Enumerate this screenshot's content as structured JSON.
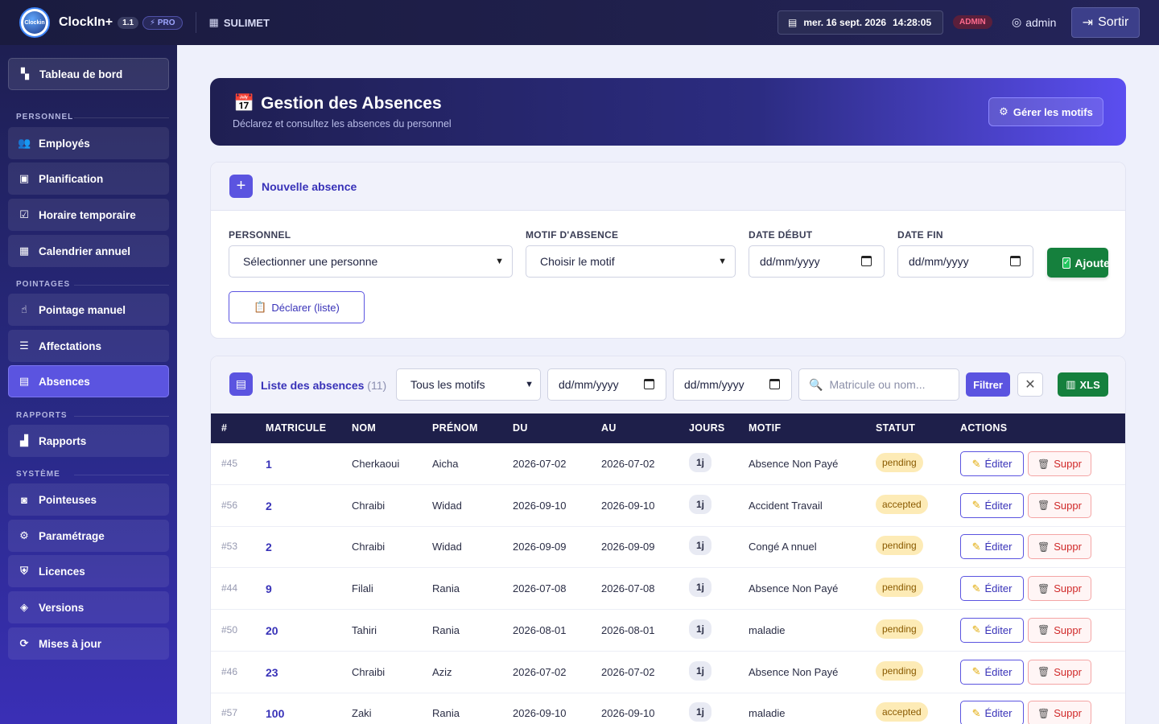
{
  "topbar": {
    "logo_text": "Clockin",
    "brand": "ClockIn+",
    "version": "1.1",
    "pro": "⚡ PRO",
    "company": "SULIMET",
    "datetime_date": "mer. 16 sept. 2026",
    "datetime_time": "14:28:05",
    "role_badge": "ADMIN",
    "user": "admin",
    "logout": "Sortir"
  },
  "sidebar": {
    "dashboard": "Tableau de bord",
    "sections": {
      "personnel": "PERSONNEL",
      "pointages": "POINTAGES",
      "rapports": "RAPPORTS",
      "systeme": "SYSTÈME"
    },
    "items": [
      {
        "label": "Employés",
        "icon": "users-icon"
      },
      {
        "label": "Planification",
        "icon": "calendar-icon"
      },
      {
        "label": "Horaire temporaire",
        "icon": "calendar-check-icon"
      },
      {
        "label": "Calendrier annuel",
        "icon": "calendar-annual-icon"
      },
      {
        "label": "Pointage manuel",
        "icon": "hand-pointer-icon"
      },
      {
        "label": "Affectations",
        "icon": "sliders-icon"
      },
      {
        "label": "Absences",
        "icon": "calendar-x-icon"
      },
      {
        "label": "Rapports",
        "icon": "bar-chart-icon"
      },
      {
        "label": "Pointeuses",
        "icon": "device-icon"
      },
      {
        "label": "Paramétrage",
        "icon": "gear-icon"
      },
      {
        "label": "Licences",
        "icon": "shield-icon"
      },
      {
        "label": "Versions",
        "icon": "layers-icon"
      },
      {
        "label": "Mises à jour",
        "icon": "refresh-icon"
      }
    ]
  },
  "header": {
    "title": "Gestion des Absences",
    "subtitle": "Déclarez et consultez les absences du personnel",
    "manage_button": "Gérer les motifs"
  },
  "new_absence": {
    "title": "Nouvelle absence",
    "personnel_label": "PERSONNEL",
    "personnel_value": "Sélectionner une personne",
    "motif_label": "MOTIF D'ABSENCE",
    "motif_value": "Choisir le motif",
    "start_label": "DATE DÉBUT",
    "start_value": "dd/mm/yyyy",
    "end_label": "DATE FIN",
    "end_value": "dd/mm/yyyy",
    "add_button": "Ajouter",
    "declare_button": "Déclarer (liste)"
  },
  "list": {
    "title": "Liste des absences",
    "count": "(11)",
    "motif_filter": "Tous les motifs",
    "date_from": "dd/mm/yyyy",
    "date_to": "dd/mm/yyyy",
    "search_placeholder": "Matricule ou nom...",
    "filter_button": "Filtrer",
    "clear_button": "✕",
    "export_button": "XLS",
    "columns": [
      "#",
      "MATRICULE",
      "NOM",
      "PRÉNOM",
      "DU",
      "AU",
      "JOURS",
      "MOTIF",
      "STATUT",
      "ACTIONS"
    ],
    "edit_label": "Éditer",
    "delete_label": "Suppr",
    "rows": [
      {
        "id": "#45",
        "matricule": "1",
        "nom": "Cherkaoui",
        "prenom": "Aicha",
        "du": "2026-07-02",
        "au": "2026-07-02",
        "jours": "1j",
        "motif": "Absence Non Payé",
        "statut": "pending"
      },
      {
        "id": "#56",
        "matricule": "2",
        "nom": "Chraibi",
        "prenom": "Widad",
        "du": "2026-09-10",
        "au": "2026-09-10",
        "jours": "1j",
        "motif": "Accident Travail",
        "statut": "accepted"
      },
      {
        "id": "#53",
        "matricule": "2",
        "nom": "Chraibi",
        "prenom": "Widad",
        "du": "2026-09-09",
        "au": "2026-09-09",
        "jours": "1j",
        "motif": "Congé A nnuel",
        "statut": "pending"
      },
      {
        "id": "#44",
        "matricule": "9",
        "nom": "Filali",
        "prenom": "Rania",
        "du": "2026-07-08",
        "au": "2026-07-08",
        "jours": "1j",
        "motif": "Absence Non Payé",
        "statut": "pending"
      },
      {
        "id": "#50",
        "matricule": "20",
        "nom": "Tahiri",
        "prenom": "Rania",
        "du": "2026-08-01",
        "au": "2026-08-01",
        "jours": "1j",
        "motif": "maladie",
        "statut": "pending"
      },
      {
        "id": "#46",
        "matricule": "23",
        "nom": "Chraibi",
        "prenom": "Aziz",
        "du": "2026-07-02",
        "au": "2026-07-02",
        "jours": "1j",
        "motif": "Absence Non Payé",
        "statut": "pending"
      },
      {
        "id": "#57",
        "matricule": "100",
        "nom": "Zaki",
        "prenom": "Rania",
        "du": "2026-09-10",
        "au": "2026-09-10",
        "jours": "1j",
        "motif": "maladie",
        "statut": "accepted"
      }
    ]
  },
  "colors": {
    "accent": "#5b54e0",
    "topbar": "#1a1b3f",
    "success": "#15803d",
    "danger": "#d02a2a",
    "status_bg": "#fdebb6"
  }
}
